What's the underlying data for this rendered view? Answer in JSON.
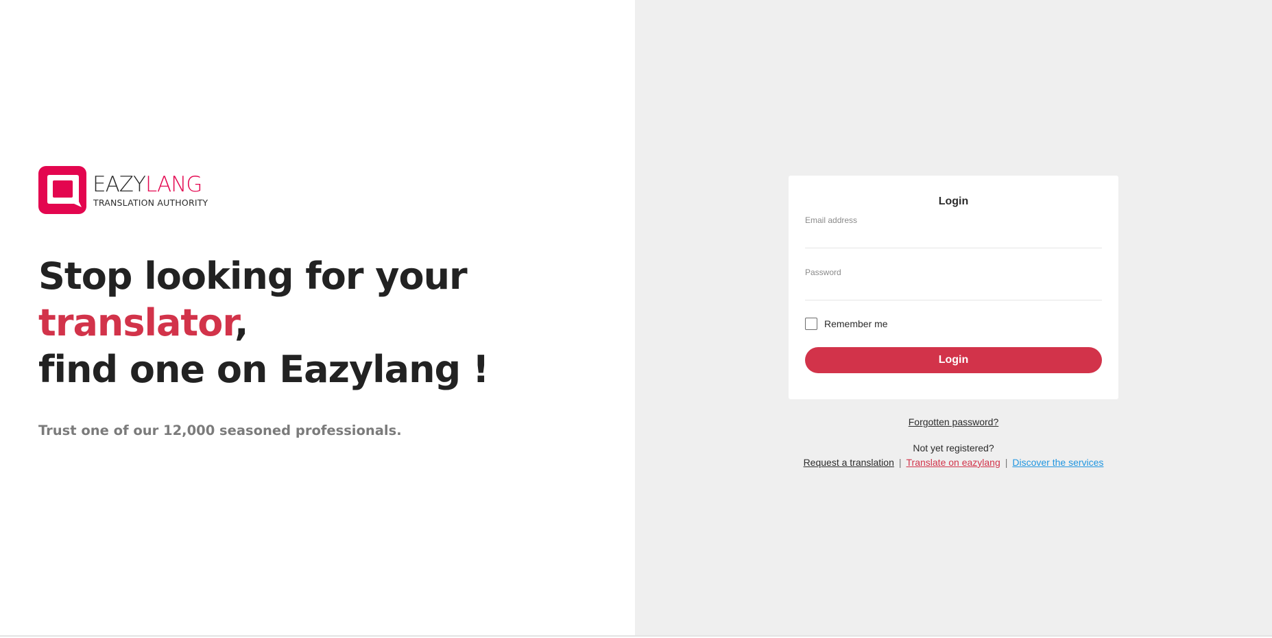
{
  "colors": {
    "brand": "#e3064f",
    "accent": "#d2334a",
    "link_blue": "#2196e0",
    "right_panel_bg": "#efefef"
  },
  "logo": {
    "word_part1": "EAZY",
    "word_part2": "LANG",
    "tagline": "TRANSLATION AUTHORITY"
  },
  "hero": {
    "line1": "Stop looking for your",
    "line2_accent": "translator",
    "line2_rest": ",",
    "line3": "find one on Eazylang !",
    "tagline": "Trust one of our 12,000 seasoned professionals."
  },
  "login_form": {
    "title": "Login",
    "email_label": "Email address",
    "email_value": "",
    "password_label": "Password",
    "password_value": "",
    "remember_label": "Remember me",
    "remember_checked": false,
    "submit_label": "Login"
  },
  "footer_links": {
    "forgot_password": "Forgotten password?",
    "not_registered": "Not yet registered?",
    "request_translation": "Request a translation",
    "translate_on": "Translate on eazylang",
    "discover_services": "Discover the services",
    "separator": "|"
  }
}
